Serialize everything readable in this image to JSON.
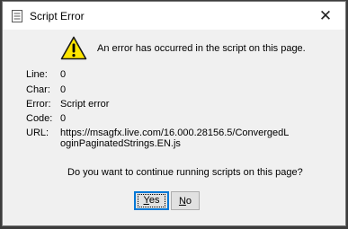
{
  "window": {
    "title": "Script Error",
    "close_glyph": "✕"
  },
  "dialog": {
    "message": "An error has occurred in the script on this page.",
    "icon": "warning-icon",
    "details": [
      {
        "label": "Line:",
        "value": "0"
      },
      {
        "label": "Char:",
        "value": "0"
      },
      {
        "label": "Error:",
        "value": "Script error"
      },
      {
        "label": "Code:",
        "value": "0"
      }
    ],
    "url_label": "URL:",
    "url_value": "https://msagfx.live.com/16.000.28156.5/ConvergedLoginPaginatedStrings.EN.js",
    "question": "Do you want to continue running scripts on this page?",
    "yes_mnemonic": "Y",
    "yes_rest": "es",
    "no_mnemonic": "N",
    "no_rest": "o"
  },
  "colors": {
    "accent": "#0078d7",
    "warning_fill": "#ffe600",
    "dialog_bg": "#f0f0f0"
  }
}
